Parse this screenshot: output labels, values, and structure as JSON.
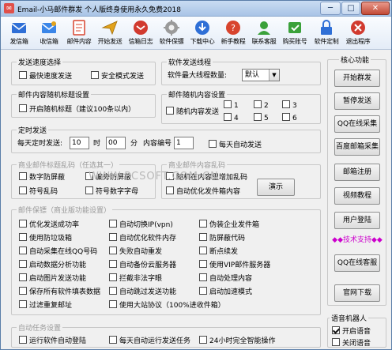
{
  "window": {
    "title": "Email-小马邮件群发 个人版终身使用永久免费2018",
    "icon_text": "✉",
    "minimize_label": "─",
    "maximize_label": "□",
    "close_label": "✕"
  },
  "toolbar": [
    {
      "label": "发信箱",
      "icon": "outbox-icon",
      "color": "#2f6fd6"
    },
    {
      "label": "收信箱",
      "icon": "inbox-icon",
      "color": "#2f6fd6"
    },
    {
      "label": "邮件内容",
      "icon": "mail-content-icon",
      "color": "#d8442e"
    },
    {
      "label": "开始发送",
      "icon": "send-icon",
      "color": "#e2a21c"
    },
    {
      "label": "信箱日志",
      "icon": "log-icon",
      "color": "#d13a2f"
    },
    {
      "label": "软件保镖",
      "icon": "guard-icon",
      "color": "#888888"
    },
    {
      "label": "下载中心",
      "icon": "download-icon",
      "color": "#2f6fd6"
    },
    {
      "label": "新手教程",
      "icon": "tutorial-icon",
      "color": "#d8442e"
    },
    {
      "label": "联系客服",
      "icon": "support-icon",
      "color": "#3aa13a"
    },
    {
      "label": "购买账号",
      "icon": "buy-icon",
      "color": "#3aa13a"
    },
    {
      "label": "软件定制",
      "icon": "customize-icon",
      "color": "#2f6fd6"
    },
    {
      "label": "退出程序",
      "icon": "exit-icon",
      "color": "#d13a2f"
    }
  ],
  "speed": {
    "title": "发送速度选择",
    "fastest": "最快速度发送",
    "safe": "安全模式发送"
  },
  "thread": {
    "title": "软件发送线程",
    "max_label": "软件最大线程数量:",
    "value": "默认",
    "arrow": "▼"
  },
  "random_title": {
    "title": "邮件内容随机标题设置",
    "enable": "开启随机标题（建议100条以内）"
  },
  "random_content": {
    "title": "邮件随机内容设置",
    "enable": "随机内容发送",
    "options": [
      "1",
      "2",
      "3",
      "4",
      "5",
      "6"
    ]
  },
  "timer": {
    "title": "定时发送",
    "daily_label": "每天定时发送:",
    "hour_value": "10",
    "hour_unit": "时",
    "minute_value": "00",
    "minute_unit": "分",
    "content_no_label": "内容编号",
    "content_no_value": "1",
    "auto_send": "每天自动发送"
  },
  "biz_title_random": {
    "title": "商业邮件标题乱码（任选其一）",
    "digit_anti": "数字防屏蔽",
    "bias_anti": "偏旁防屏蔽",
    "symbol_garble": "符号乱码",
    "symbol_digit": "符号数字字母"
  },
  "biz_content_random": {
    "title": "商业邮件内容乱码",
    "add_garble": "随机在内容里增加乱码",
    "auto_optimize": "自动优化发件箱内容",
    "demo_button": "演示"
  },
  "watermark": "WWW.PCSOFT.COM.CN",
  "mail_guard": {
    "title": "邮件保镖（商业版功能设置）",
    "col1": [
      "优化发送成功率",
      "使用防垃圾箱",
      "自动采集在线QQ号码",
      "启动数据分析功能",
      "启动图片发送功能",
      "保存所有软件填表数据",
      "过滤重复邮址"
    ],
    "col2": [
      "自动切换IP(vpn)",
      "自动优化软件内存",
      "失败自动重发",
      "自动备份云服务器",
      "拦截非法字眼",
      "自动跳过发送功能",
      "使用大站协议（100%进收件箱）"
    ],
    "col3": [
      "伪装企业发件箱",
      "防屏蔽代码",
      "断点续发",
      "使用VIP邮件服务器",
      "自动处理内容",
      "启动加速模式"
    ]
  },
  "auto_task": {
    "title": "自动任务设置",
    "run_on_start": "运行软件自动登陆",
    "daily_auto": "每天自动运行发送任务",
    "smart_24h": "24小时完全智能操作"
  },
  "core": {
    "title": "核心功能",
    "buttons": [
      "开始群发",
      "暂停发送",
      "QQ在线采集",
      "百度邮箱采集",
      "邮箱注册",
      "视频教程",
      "用户登陆"
    ],
    "support_text": "◆◆技术支持◆◆",
    "qq_service": "QQ在线客服",
    "official_download": "官网下载"
  },
  "voice": {
    "title": "语音机器人",
    "on": "开启语音",
    "off": "关闭语音"
  }
}
